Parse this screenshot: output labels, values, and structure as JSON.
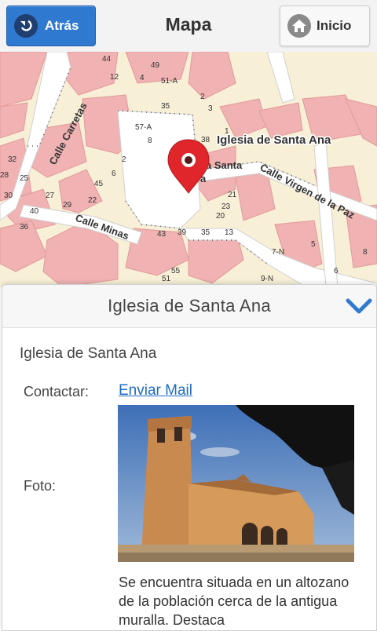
{
  "header": {
    "back_label": "Atrás",
    "title": "Mapa",
    "home_label": "Inicio"
  },
  "map": {
    "marker_label": "Iglesia de Santa Ana",
    "streets": [
      "Calle Carretas",
      "Calle Minas",
      "Calle Virgen de la Paz"
    ],
    "partial_labels": [
      "a Santa",
      "a"
    ],
    "house_numbers": [
      "44",
      "12",
      "4",
      "49",
      "51-A",
      "2",
      "3",
      "35",
      "57-A",
      "8",
      "38",
      "1",
      "2",
      "32",
      "28",
      "25",
      "6",
      "45",
      "22",
      "27",
      "29",
      "30",
      "36",
      "40",
      "43",
      "39",
      "35",
      "13",
      "21",
      "23",
      "20",
      "55",
      "51",
      "7-N",
      "9-N",
      "5",
      "6",
      "8"
    ]
  },
  "panel": {
    "title": "Iglesia de Santa Ana",
    "name": "Iglesia de Santa Ana",
    "contact_label": "Contactar:",
    "contact_link": "Enviar Mail",
    "photo_label": "Foto:",
    "description": "Se encuentra situada en un altozano de la población cerca de la antigua muralla. Destaca"
  },
  "colors": {
    "accent": "#2f7ad0",
    "link": "#1e6dc1",
    "marker": "#e0252b",
    "building": "#f0b2b2",
    "map_bg": "#f7efd6"
  }
}
